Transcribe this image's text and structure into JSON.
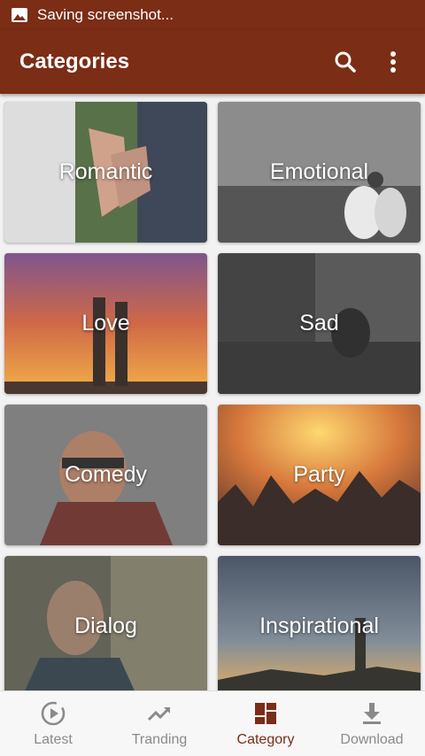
{
  "status_bar": {
    "text": "Saving screenshot...",
    "icon": "image-icon"
  },
  "app_bar": {
    "title": "Categories",
    "actions": [
      "search-icon",
      "more-vert-icon"
    ]
  },
  "categories": [
    {
      "label": "Romantic"
    },
    {
      "label": "Emotional"
    },
    {
      "label": "Love"
    },
    {
      "label": "Sad"
    },
    {
      "label": "Comedy"
    },
    {
      "label": "Party"
    },
    {
      "label": "Dialog"
    },
    {
      "label": "Inspirational"
    }
  ],
  "bottom_nav": {
    "items": [
      {
        "label": "Latest",
        "icon": "play-circle-icon"
      },
      {
        "label": "Tranding",
        "icon": "trending-up-icon"
      },
      {
        "label": "Category",
        "icon": "grid-icon",
        "active": true
      },
      {
        "label": "Download",
        "icon": "download-icon"
      }
    ]
  },
  "colors": {
    "primary": "#7b2d16",
    "inactive": "#8a8a8a",
    "nav_bg": "#f7f7f7"
  }
}
